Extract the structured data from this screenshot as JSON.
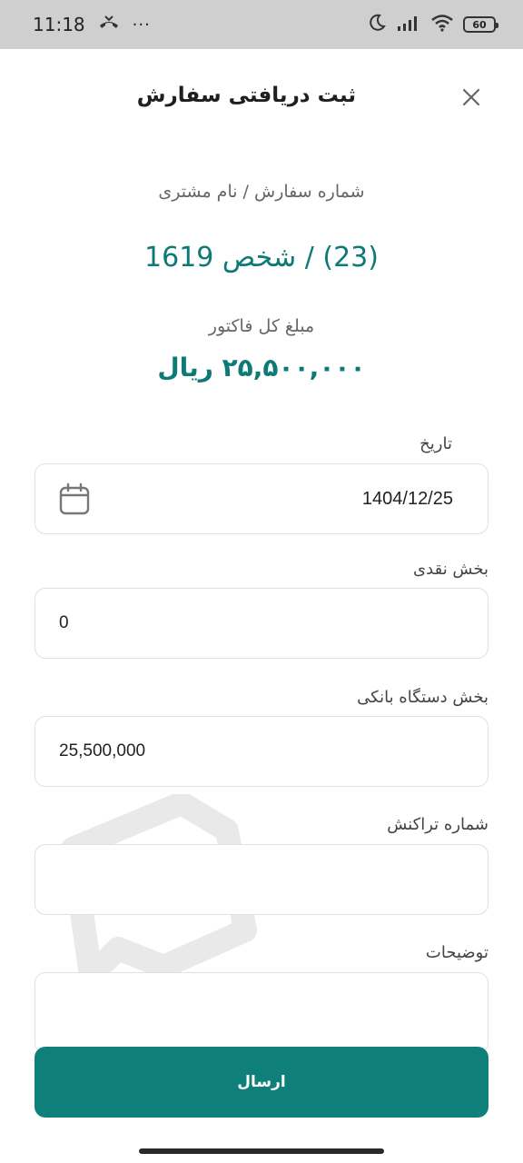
{
  "status_bar": {
    "time": "11:18",
    "dots": "···",
    "battery": "60"
  },
  "header": {
    "title": "ثبت دریافتی سفارش"
  },
  "order": {
    "label": "شماره سفارش / نام مشتری",
    "value": "(23) / شخص 1619"
  },
  "invoice": {
    "label": "مبلغ کل فاکتور",
    "amount": "۲۵,۵۰۰,۰۰۰ ریال"
  },
  "form": {
    "date_label": "تاریخ",
    "date_value": "1404/12/25",
    "cash_label": "بخش نقدی",
    "cash_value": "0",
    "pos_label": "بخش دستگاه بانکی",
    "pos_value": "25,500,000",
    "transaction_label": "شماره تراکنش",
    "transaction_value": "",
    "notes_label": "توضیحات",
    "notes_value": ""
  },
  "actions": {
    "submit_label": "ارسال"
  },
  "colors": {
    "accent": "#0e7f79",
    "status_bar": "#cfcfcf"
  }
}
